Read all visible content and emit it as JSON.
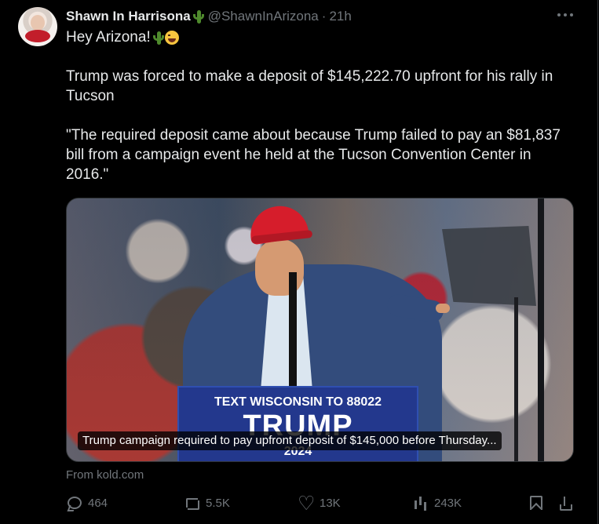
{
  "post": {
    "author_name": "Shawn In Harrisona",
    "handle": "@ShawnInArizona",
    "separator": "·",
    "time": "21h",
    "line1": "Hey Arizona!",
    "line2": "Trump was forced to make a deposit of $145,222.70 upfront for his rally in Tucson",
    "line3": "\"The required deposit came about because Trump failed to pay an $81,837 bill from a campaign event he held at the Tucson Convention Center in 2016.\"",
    "emoji_1": "cactus-icon",
    "emoji_2": "laughing-face-icon"
  },
  "media": {
    "caption": "Trump campaign required to pay upfront deposit of $145,000 before Thursday...",
    "sign_line1": "TEXT WISCONSIN TO 88022",
    "sign_line2": "TRUMP",
    "sign_line3": "2024"
  },
  "source": "From kold.com",
  "actions": {
    "replies": "464",
    "reposts": "5.5K",
    "likes": "13K",
    "views": "243K"
  },
  "colors": {
    "background": "#000000",
    "text": "#e7e9ea",
    "muted": "#71767b",
    "border": "#2f3336"
  }
}
